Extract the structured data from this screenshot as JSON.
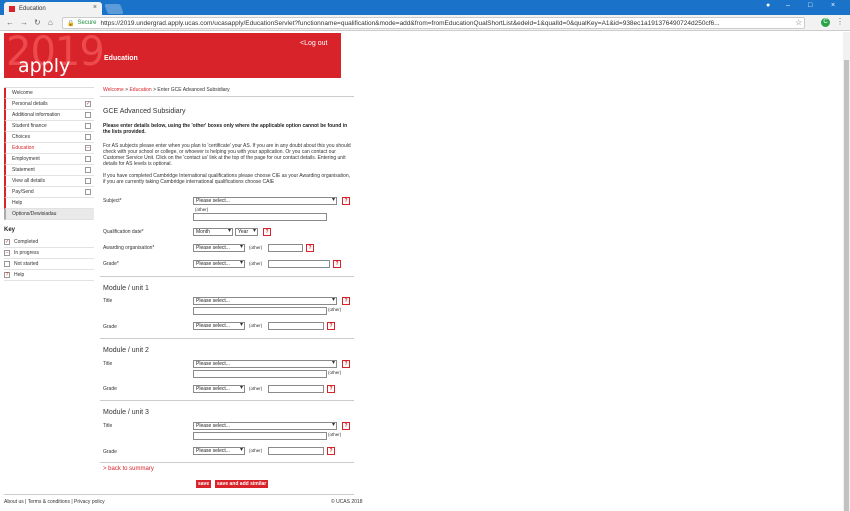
{
  "browser": {
    "tab_title": "Education",
    "secure": "Secure",
    "url": "https://2019.undergrad.apply.ucas.com/ucasapply/EducationServlet?functionname=qualification&mode=add&from=fromEducationQualShortList&edeld=1&qualId=0&qualKey=A1&id=938ec1a191376490724d250cf6..."
  },
  "banner": {
    "year": "2019",
    "apply": "apply",
    "title": "Education",
    "logout": "<Log out"
  },
  "nav": {
    "items": [
      {
        "label": "Welcome",
        "state": ""
      },
      {
        "label": "Personal details",
        "state": "✓"
      },
      {
        "label": "Additional information",
        "state": ""
      },
      {
        "label": "Student finance",
        "state": ""
      },
      {
        "label": "Choices",
        "state": ""
      },
      {
        "label": "Education",
        "state": "–"
      },
      {
        "label": "Employment",
        "state": ""
      },
      {
        "label": "Statement",
        "state": ""
      },
      {
        "label": "View all details",
        "state": ""
      },
      {
        "label": "Pay/Send",
        "state": ""
      },
      {
        "label": "Help",
        "state": ""
      },
      {
        "label": "Options/Dewisiadau",
        "state": ""
      }
    ]
  },
  "key": {
    "title": "Key",
    "completed": "Completed",
    "in_progress": "In progress",
    "not_started": "Not started",
    "help": "Help",
    "help_symbol": "?",
    "check_symbol": "✓",
    "dash_symbol": "–"
  },
  "breadcrumb": {
    "welcome": "Welcome",
    "education": "Education",
    "current": "Enter GCE Advanced Subsidiary",
    "sep": ">"
  },
  "main": {
    "heading": "GCE Advanced Subsidiary",
    "intro_bold": "Please enter details below, using the 'other' boxes only where the applicable option cannot be found in the lists provided.",
    "intro_p1": "For AS subjects please enter when you plan to 'certificate' your AS. If you are in any doubt about this you should check with your school or college, or whoever is helping you with your application. Or you can contact our Customer Service Unit. Click on the 'contact us' link at the top of the page for our contact details. Entering unit details for AS levels is optional.",
    "intro_p2": "If you have completed Cambridge International qualifications please choose CIE as your Awarding organisation, if you are currently taking Cambridge international qualifications choose CAIE",
    "subject_label": "Subject*",
    "qual_date_label": "Qualification date*",
    "awarding_label": "Awarding organisation*",
    "grade_label": "Grade*",
    "unit_title_label": "Title",
    "unit_grade_label": "Grade",
    "select_placeholder": "Please select...",
    "month": "Month",
    "year": "Year",
    "other": "(other)",
    "help": "?",
    "module1": "Module / unit 1",
    "module2": "Module / unit 2",
    "module3": "Module / unit 3",
    "back": "> back to summary",
    "save": "save",
    "save_add": "save and add similar"
  },
  "footer": {
    "left": "About us | Terms & conditions | Privacy policy",
    "right": "© UCAS 2018"
  }
}
